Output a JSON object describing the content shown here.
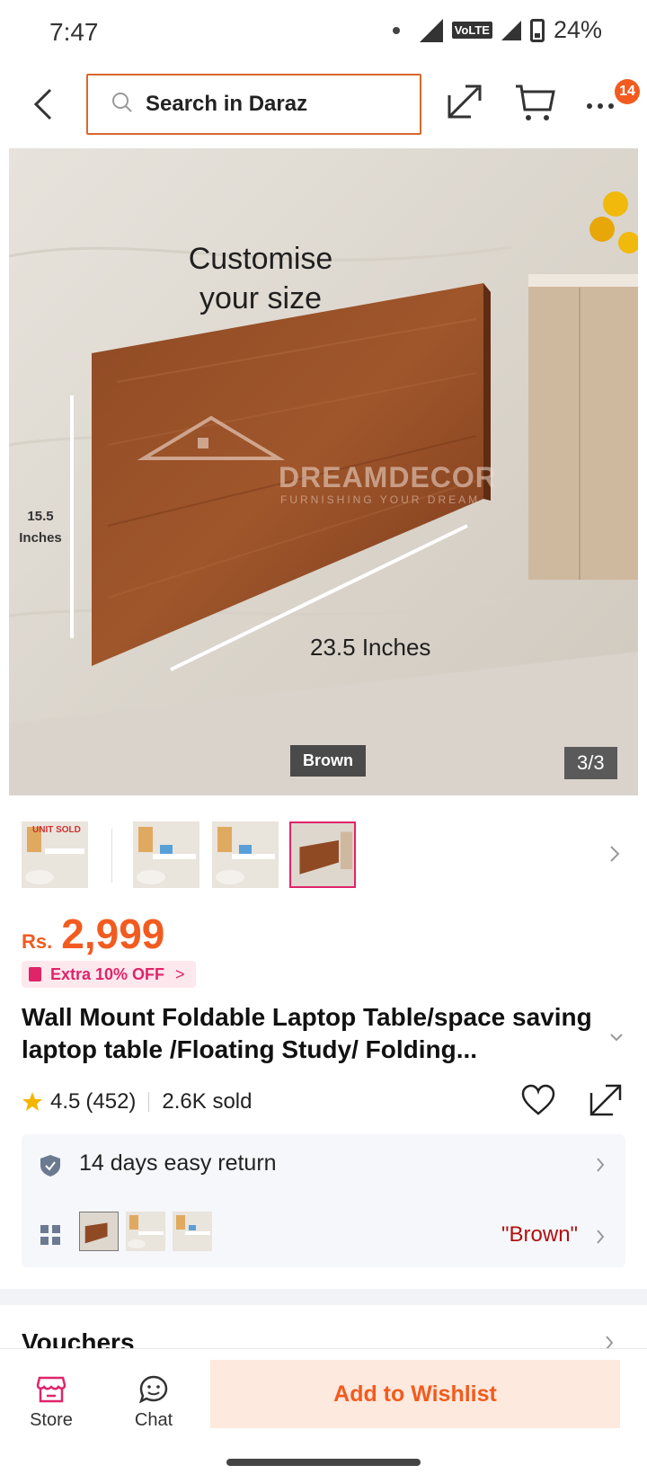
{
  "status_bar": {
    "time": "7:47",
    "network_label": "VoLTE",
    "battery": "24%"
  },
  "header": {
    "search_placeholder": "Search in Daraz",
    "cart_badge": "14",
    "icons": [
      "back-arrow-icon",
      "search-icon",
      "share-icon",
      "cart-icon",
      "more-icon"
    ]
  },
  "gallery": {
    "caption_line1": "Customise",
    "caption_line2": "your size",
    "height_label_line1": "15.5",
    "height_label_line2": "Inches",
    "width_label": "23.5 Inches",
    "watermark": "DREAMDECOR",
    "watermark_sub": "FURNISHING YOUR DREAM",
    "variant_tag": "Brown",
    "counter": "3/3",
    "thumb_label": "UNIT SOLD",
    "thumbnail_count": 4,
    "active_thumbnail": 4
  },
  "price": {
    "currency": "Rs.",
    "value": "2,999"
  },
  "promo": {
    "label": "Extra 10% OFF",
    "chevron": ">"
  },
  "product": {
    "title": "Wall Mount Foldable Laptop Table/space saving laptop table /Floating Study/ Folding...",
    "rating": "4.5",
    "reviews": "(452)",
    "sold": "2.6K sold"
  },
  "service": {
    "return_policy": "14 days easy return",
    "selected_variant": "\"Brown\""
  },
  "vouchers": {
    "title": "Vouchers"
  },
  "bottom_bar": {
    "store_label": "Store",
    "chat_label": "Chat",
    "wishlist_label": "Add to Wishlist"
  },
  "colors": {
    "accent": "#f25b1f",
    "promo_pink": "#e0246a",
    "variant_red": "#b30f0f",
    "wishlist_bg": "#fde9dd"
  }
}
